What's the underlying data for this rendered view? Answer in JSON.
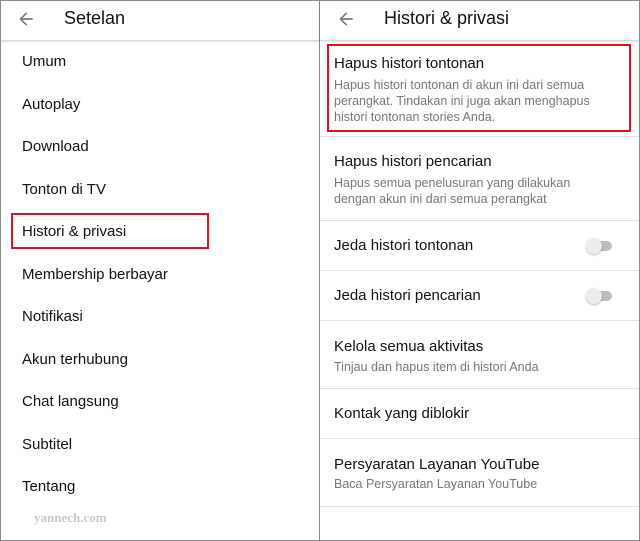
{
  "left": {
    "title": "Setelan",
    "items": [
      "Umum",
      "Autoplay",
      "Download",
      "Tonton di TV",
      "Histori & privasi",
      "Membership berbayar",
      "Notifikasi",
      "Akun terhubung",
      "Chat langsung",
      "Subtitel",
      "Tentang"
    ],
    "highlighted_item": "Histori & privasi"
  },
  "right": {
    "title": "Histori & privasi",
    "items": [
      {
        "title": "Hapus histori tontonan",
        "sub1": "Hapus histori tontonan di akun ini dari semua",
        "sub2": "perangkat. Tindakan ini juga akan menghapus",
        "sub3": "histori tontonan stories Anda."
      },
      {
        "title": "Hapus histori pencarian",
        "sub1": "Hapus semua penelusuran yang dilakukan",
        "sub2": "dengan akun ini dari semua perangkat"
      },
      {
        "title": "Jeda histori tontonan",
        "toggle": "off"
      },
      {
        "title": "Jeda histori pencarian",
        "toggle": "off"
      },
      {
        "title": "Kelola semua aktivitas",
        "sub1": "Tinjau dan hapus item di histori Anda"
      },
      {
        "title": "Kontak yang diblokir"
      },
      {
        "title": "Persyaratan Layanan YouTube",
        "sub1": "Baca Persyaratan Layanan YouTube"
      }
    ]
  },
  "icons": {
    "back": "arrow-left-icon"
  },
  "watermark": "yannech.com",
  "highlight_color": "#e0101c"
}
